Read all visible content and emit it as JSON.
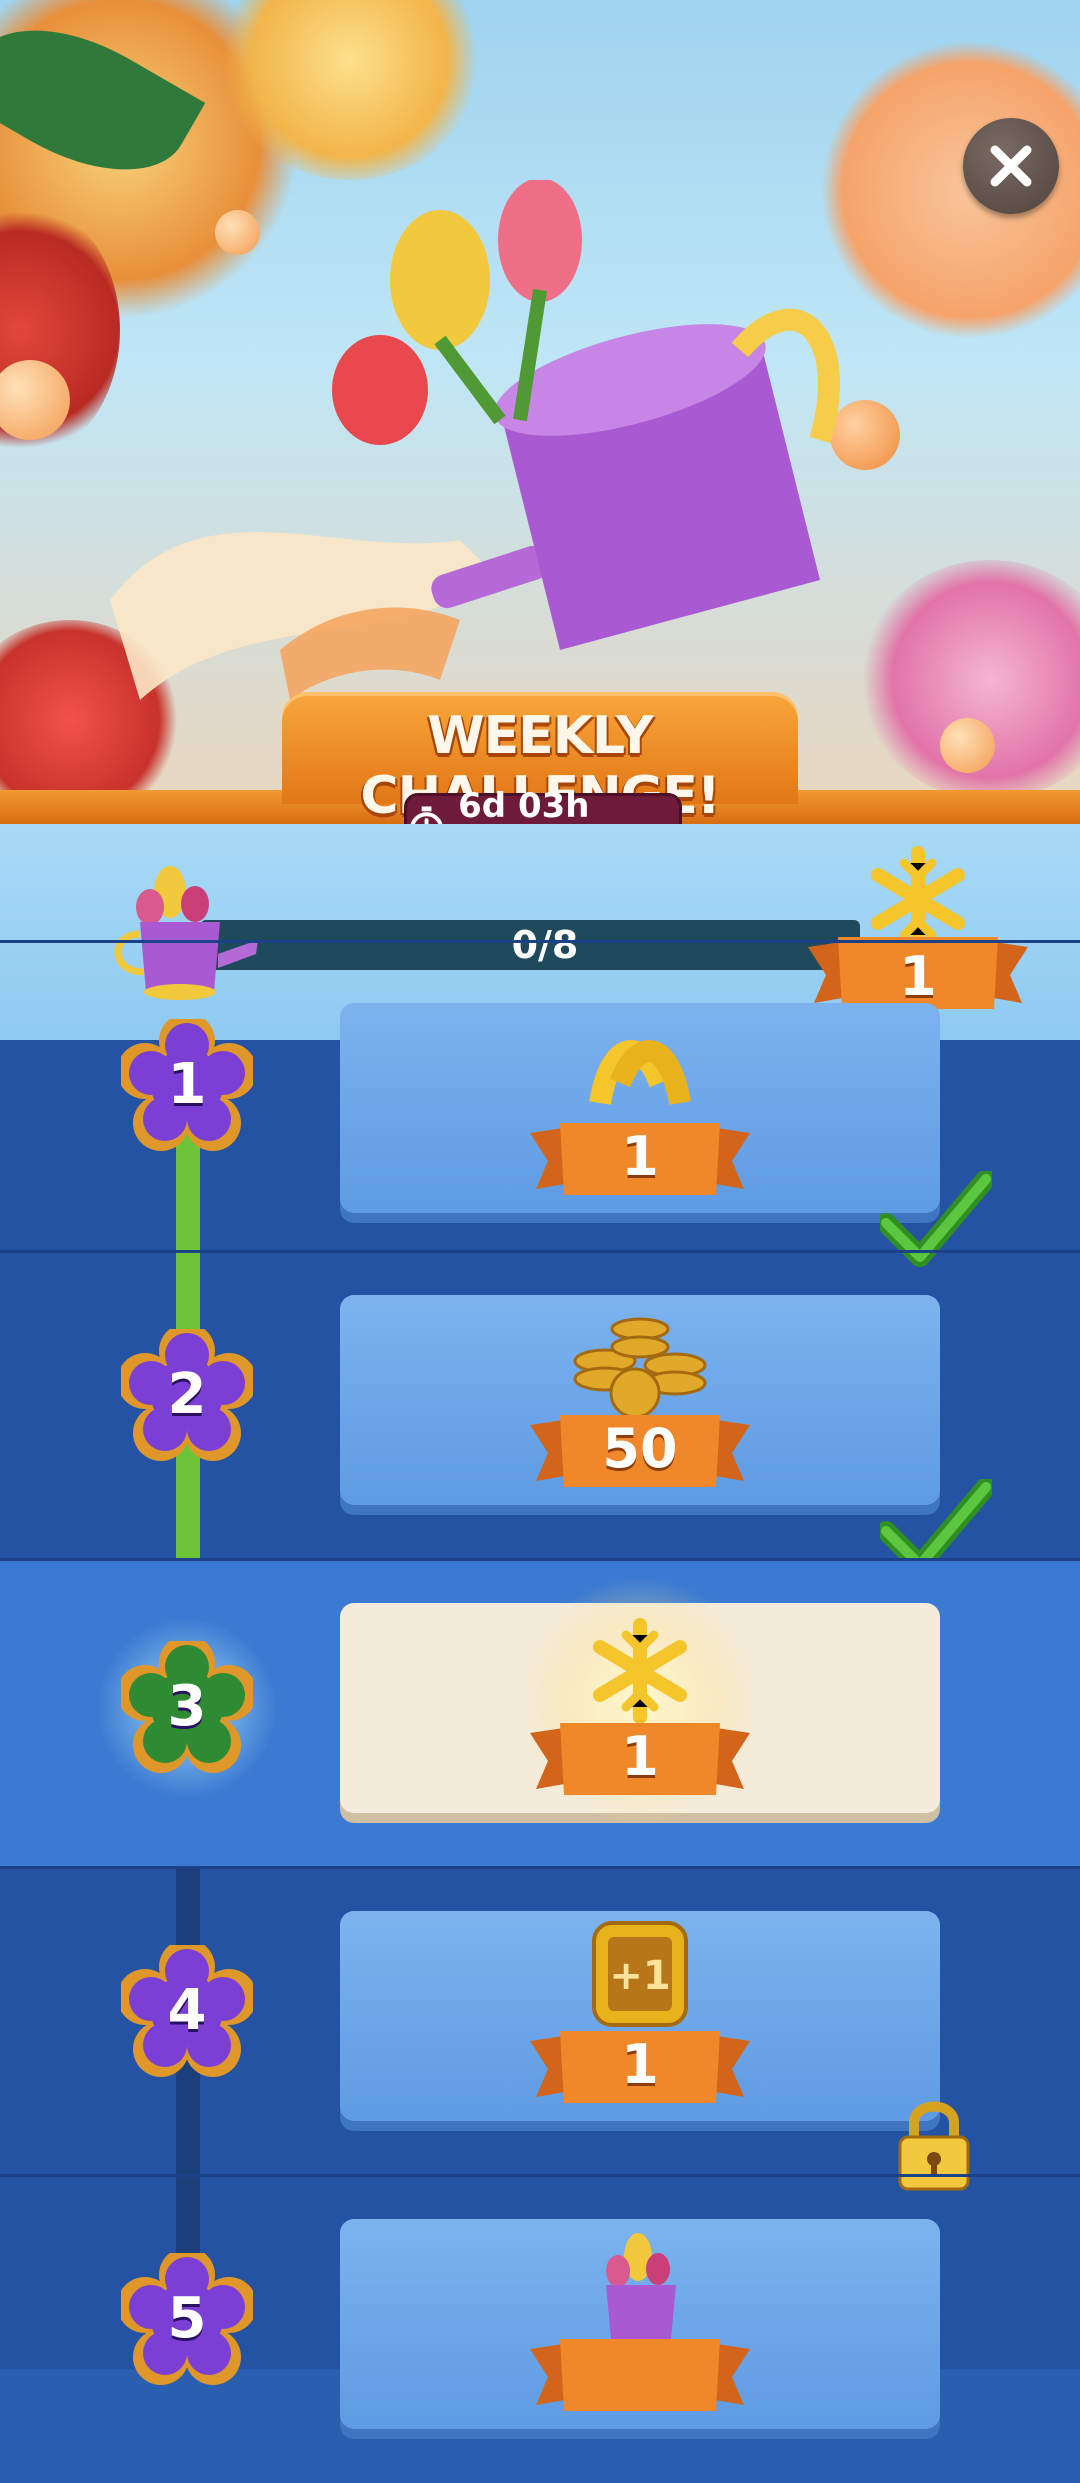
{
  "header": {
    "title": "WEEKLY CHALLENGE!",
    "timer": "6d 03h 30m",
    "close_icon": "close-icon"
  },
  "progress": {
    "text": "0/8",
    "value": 0,
    "max": 8,
    "reward_count": "1",
    "reward_icon": "snowflake-icon",
    "start_icon": "watering-can-icon"
  },
  "milestones": [
    {
      "step": "1",
      "reward_icon": "ribbon-icon",
      "reward_count": "1",
      "status": "claimed"
    },
    {
      "step": "2",
      "reward_icon": "coins-icon",
      "reward_count": "50",
      "status": "claimed"
    },
    {
      "step": "3",
      "reward_icon": "snowflake-icon",
      "reward_count": "1",
      "status": "current"
    },
    {
      "step": "4",
      "reward_icon": "plus-one-booster-icon",
      "reward_count": "1",
      "status": "locked"
    },
    {
      "step": "5",
      "reward_icon": "watering-can-icon",
      "reward_count": "",
      "status": "locked"
    }
  ],
  "colors": {
    "orange": "#e27716",
    "purple_badge": "#7b3fd6",
    "green_badge": "#2f8a34",
    "card_blue": "#6fa9ec",
    "card_current": "#f4ebdb",
    "check_green": "#3aa52a",
    "progress_track": "#1f4a5c"
  }
}
